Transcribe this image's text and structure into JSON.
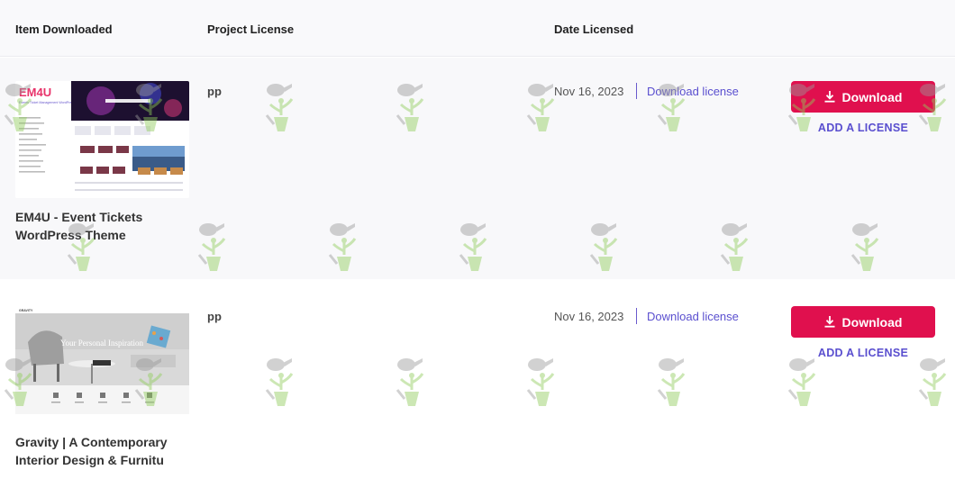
{
  "table": {
    "headers": {
      "item": "Item Downloaded",
      "license": "Project License",
      "date": "Date Licensed"
    },
    "rows": [
      {
        "thumb": {
          "logo": "EM4U",
          "tagline": "Events Ticket Management WordPress Theme"
        },
        "title": "EM4U - Event Tickets WordPress Theme",
        "license": "pp",
        "date": "Nov 16, 2023",
        "download_link": "Download license",
        "download_button": "Download",
        "add_license": "ADD A LICENSE"
      },
      {
        "thumb": {
          "brand": "GRAVITY",
          "headline": "Your Personal Inspiration"
        },
        "title": "Gravity | A Contemporary Interior Design & Furnitu",
        "license": "pp",
        "date": "Nov 16, 2023",
        "download_link": "Download license",
        "download_button": "Download",
        "add_license": "ADD A LICENSE"
      }
    ]
  },
  "colors": {
    "accent": "#e0104e",
    "link": "#5a4fcf",
    "header_bg": "#f9f9fb"
  },
  "icons": {
    "download": "download-arrow-icon",
    "watermark": "watering-can-plant-watermark"
  }
}
